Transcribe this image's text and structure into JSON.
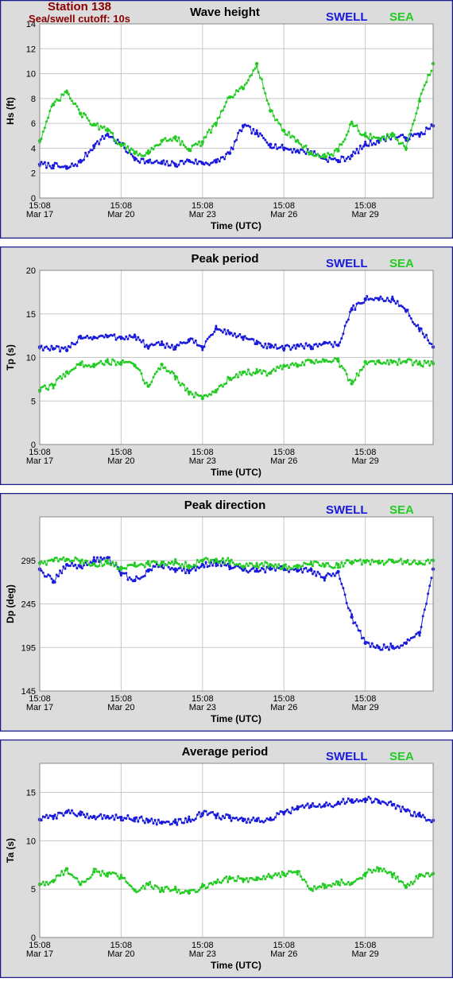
{
  "station": {
    "title": "Station 138",
    "subtitle": "Sea/swell cutoff: 10s"
  },
  "colors": {
    "swell": "#1a1adc",
    "sea": "#22cc22",
    "panel_border": "#1a1a8c",
    "panel_bg": "#dcdcdc",
    "plot_bg": "#ffffff",
    "grid": "#c8c8c8"
  },
  "legend": {
    "swell": "SWELL",
    "sea": "SEA"
  },
  "x_axis": {
    "label": "Time (UTC)",
    "ticks": [
      {
        "time": "15:08",
        "date": "Mar 17"
      },
      {
        "time": "15:08",
        "date": "Mar 20"
      },
      {
        "time": "15:08",
        "date": "Mar 23"
      },
      {
        "time": "15:08",
        "date": "Mar 26"
      },
      {
        "time": "15:08",
        "date": "Mar 29"
      }
    ]
  },
  "chart_data": [
    {
      "type": "scatter",
      "title": "Wave height",
      "ylabel": "Hs (ft)",
      "xlabel": "Time (UTC)",
      "xlim": [
        "Mar 17 15:08",
        "Apr 1 15:08"
      ],
      "ylim": [
        0,
        14
      ],
      "yticks": [
        0,
        2,
        4,
        6,
        8,
        10,
        12,
        14
      ],
      "grid": true,
      "legend_position": "top-right",
      "x_days_from_start": [
        0,
        0.5,
        1,
        1.5,
        2,
        2.5,
        3,
        3.5,
        4,
        4.5,
        5,
        5.5,
        6,
        6.5,
        7,
        7.5,
        8,
        8.5,
        9,
        9.5,
        10,
        10.5,
        11,
        11.5,
        12,
        12.5,
        13,
        13.5,
        14,
        14.5
      ],
      "series": [
        {
          "name": "SWELL",
          "values": [
            2.7,
            2.6,
            2.4,
            2.9,
            4.2,
            5.1,
            4.3,
            3.2,
            2.9,
            2.8,
            2.7,
            3.0,
            2.8,
            2.9,
            3.6,
            5.8,
            5.2,
            4.3,
            4.0,
            3.8,
            3.7,
            3.2,
            3.0,
            3.4,
            4.3,
            4.6,
            5.0,
            4.8,
            5.1,
            5.8
          ]
        },
        {
          "name": "SEA",
          "values": [
            4.6,
            7.5,
            8.5,
            6.8,
            5.9,
            5.4,
            4.3,
            3.6,
            3.6,
            4.6,
            4.9,
            3.9,
            4.5,
            6.0,
            8.1,
            8.8,
            10.8,
            7.0,
            5.4,
            4.6,
            3.6,
            3.3,
            3.8,
            6.0,
            5.0,
            4.8,
            5.0,
            4.0,
            7.8,
            10.8
          ]
        }
      ]
    },
    {
      "type": "scatter",
      "title": "Peak period",
      "ylabel": "Tp (s)",
      "xlabel": "Time (UTC)",
      "xlim": [
        "Mar 17 15:08",
        "Apr 1 15:08"
      ],
      "ylim": [
        0,
        20
      ],
      "yticks": [
        0,
        5,
        10,
        15,
        20
      ],
      "grid": true,
      "legend_position": "top-right",
      "x_days_from_start": [
        0,
        0.5,
        1,
        1.5,
        2,
        2.5,
        3,
        3.5,
        4,
        4.5,
        5,
        5.5,
        6,
        6.5,
        7,
        7.5,
        8,
        8.5,
        9,
        9.5,
        10,
        10.5,
        11,
        11.5,
        12,
        12.5,
        13,
        13.5,
        14,
        14.5
      ],
      "series": [
        {
          "name": "SWELL",
          "values": [
            11.2,
            11.0,
            10.8,
            12.4,
            12.3,
            12.4,
            12.3,
            12.4,
            11.2,
            11.5,
            11.2,
            12.0,
            11.2,
            13.3,
            12.8,
            12.3,
            11.6,
            11.2,
            11.0,
            11.4,
            11.2,
            11.7,
            11.4,
            15.5,
            16.7,
            16.7,
            16.7,
            15.4,
            13.3,
            11.2
          ]
        },
        {
          "name": "SEA",
          "values": [
            6.2,
            6.8,
            8.3,
            9.2,
            9.2,
            9.5,
            9.4,
            9.1,
            6.7,
            9.2,
            7.8,
            6.0,
            5.3,
            6.2,
            7.6,
            8.3,
            8.3,
            8.2,
            9.0,
            9.0,
            9.6,
            9.6,
            9.6,
            7.0,
            9.5,
            9.5,
            9.5,
            9.5,
            9.3,
            9.3
          ]
        }
      ]
    },
    {
      "type": "scatter",
      "title": "Peak direction",
      "ylabel": "Dp (deg)",
      "xlabel": "Time (UTC)",
      "xlim": [
        "Mar 17 15:08",
        "Apr 1 15:08"
      ],
      "ylim": [
        145,
        345
      ],
      "yticks": [
        145,
        195,
        245,
        295
      ],
      "grid": true,
      "legend_position": "top-right",
      "x_days_from_start": [
        0,
        0.5,
        1,
        1.5,
        2,
        2.5,
        3,
        3.5,
        4,
        4.5,
        5,
        5.5,
        6,
        6.5,
        7,
        7.5,
        8,
        8.5,
        9,
        9.5,
        10,
        10.5,
        11,
        11.5,
        12,
        12.5,
        13,
        13.5,
        14,
        14.5
      ],
      "series": [
        {
          "name": "SWELL",
          "values": [
            285,
            270,
            290,
            288,
            295,
            298,
            280,
            272,
            283,
            290,
            285,
            283,
            290,
            292,
            288,
            284,
            283,
            285,
            286,
            283,
            284,
            275,
            282,
            230,
            200,
            195,
            196,
            200,
            212,
            285
          ]
        },
        {
          "name": "SEA",
          "values": [
            292,
            295,
            296,
            294,
            291,
            292,
            287,
            289,
            291,
            292,
            293,
            289,
            295,
            296,
            294,
            288,
            289,
            290,
            288,
            287,
            291,
            289,
            290,
            293,
            293,
            292,
            294,
            293,
            292,
            295
          ]
        }
      ]
    },
    {
      "type": "scatter",
      "title": "Average period",
      "ylabel": "Ta (s)",
      "xlabel": "Time (UTC)",
      "xlim": [
        "Mar 17 15:08",
        "Apr 1 15:08"
      ],
      "ylim": [
        0,
        18
      ],
      "yticks": [
        0,
        5,
        10,
        15
      ],
      "grid": true,
      "legend_position": "top-right",
      "x_days_from_start": [
        0,
        0.5,
        1,
        1.5,
        2,
        2.5,
        3,
        3.5,
        4,
        4.5,
        5,
        5.5,
        6,
        6.5,
        7,
        7.5,
        8,
        8.5,
        9,
        9.5,
        10,
        10.5,
        11,
        11.5,
        12,
        12.5,
        13,
        13.5,
        14,
        14.5
      ],
      "series": [
        {
          "name": "SWELL",
          "values": [
            12.2,
            12.5,
            13.0,
            12.7,
            12.5,
            12.5,
            12.4,
            12.3,
            12.1,
            11.9,
            11.9,
            12.2,
            12.8,
            12.6,
            12.4,
            12.1,
            12.1,
            12.2,
            12.9,
            13.3,
            13.6,
            13.6,
            13.9,
            14.2,
            14.3,
            14.0,
            13.7,
            13.1,
            12.6,
            12.1
          ]
        },
        {
          "name": "SEA",
          "values": [
            5.5,
            5.8,
            7.1,
            5.5,
            6.8,
            6.6,
            6.2,
            4.9,
            5.5,
            4.9,
            5.0,
            4.6,
            5.3,
            5.7,
            6.1,
            6.0,
            6.0,
            6.3,
            6.5,
            6.8,
            5.0,
            5.4,
            5.7,
            5.6,
            6.6,
            7.1,
            6.5,
            5.2,
            6.4,
            6.6
          ]
        }
      ]
    }
  ]
}
